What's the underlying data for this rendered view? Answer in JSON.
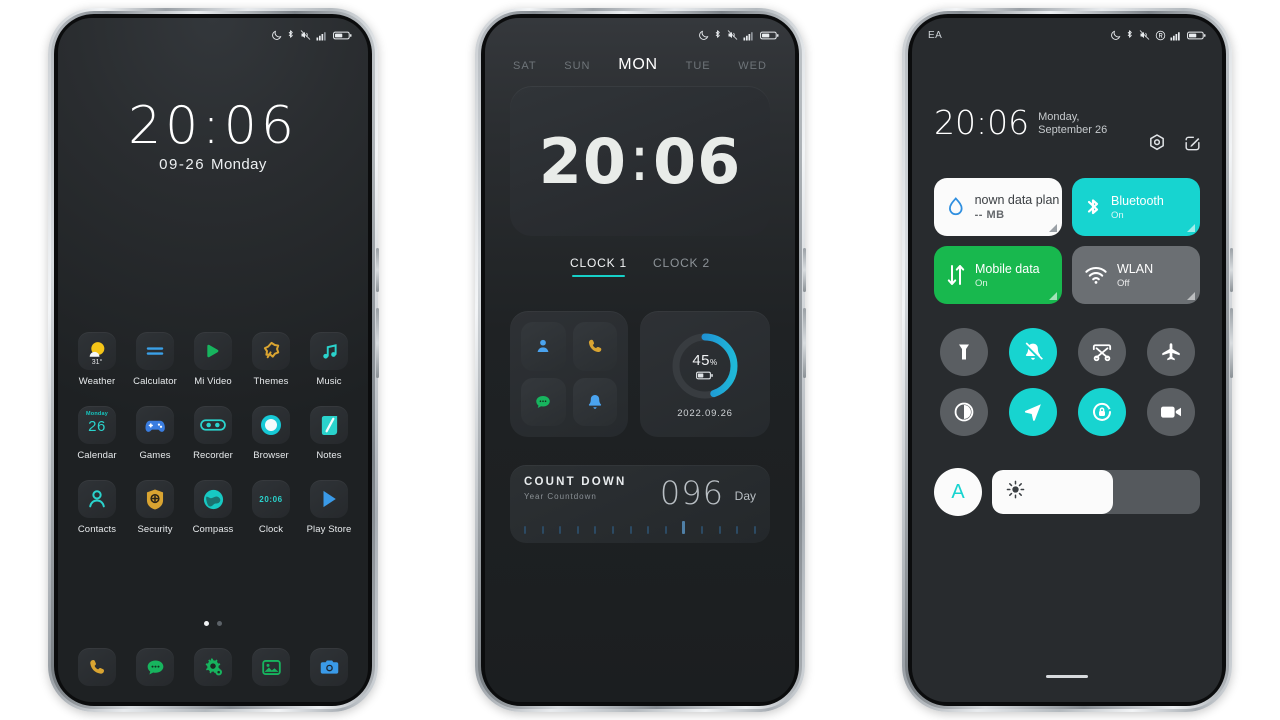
{
  "statusbar": {
    "icons": [
      "moon-icon",
      "bluetooth-icon",
      "vibrate-off-icon",
      "signal-icon",
      "battery-icon"
    ],
    "carrier": "EA",
    "icons_p3": [
      "moon-icon",
      "bluetooth-icon",
      "vibrate-off-icon",
      "registered-icon",
      "signal-icon",
      "battery-icon"
    ]
  },
  "phone1": {
    "lock": {
      "time": "20:06",
      "date": "09-26",
      "weekday": "Monday"
    },
    "apps": [
      [
        {
          "label": "Weather",
          "icon": "weather-sun-cloud-icon",
          "temp": "31°"
        },
        {
          "label": "Calculator",
          "icon": "calculator-equals-icon"
        },
        {
          "label": "Mi Video",
          "icon": "play-triangle-icon"
        },
        {
          "label": "Themes",
          "icon": "themes-star-icon"
        },
        {
          "label": "Music",
          "icon": "music-note-icon"
        }
      ],
      [
        {
          "label": "Calendar",
          "icon": "calendar-icon",
          "dow": "Monday",
          "day": "26"
        },
        {
          "label": "Games",
          "icon": "gamepad-icon"
        },
        {
          "label": "Recorder",
          "icon": "recorder-tape-icon"
        },
        {
          "label": "Browser",
          "icon": "browser-circle-icon"
        },
        {
          "label": "Notes",
          "icon": "notes-pencil-icon"
        }
      ],
      [
        {
          "label": "Contacts",
          "icon": "contacts-person-icon"
        },
        {
          "label": "Security",
          "icon": "security-shield-icon"
        },
        {
          "label": "Compass",
          "icon": "compass-globe-icon"
        },
        {
          "label": "Clock",
          "icon": "clock-digits-icon",
          "time": "20:06"
        },
        {
          "label": "Play Store",
          "icon": "play-store-icon"
        }
      ]
    ],
    "page_dots": {
      "count": 2,
      "active": 0
    },
    "dock": [
      {
        "label": "Phone",
        "icon": "phone-handset-icon"
      },
      {
        "label": "Messages",
        "icon": "message-bubble-icon"
      },
      {
        "label": "Settings",
        "icon": "settings-gears-icon"
      },
      {
        "label": "Gallery",
        "icon": "gallery-picture-icon"
      },
      {
        "label": "Camera",
        "icon": "camera-icon"
      }
    ]
  },
  "phone2": {
    "weekdays": [
      "SAT",
      "SUN",
      "MON",
      "TUE",
      "WED"
    ],
    "today_index": 2,
    "clock": {
      "hours": "20",
      "sep": ":",
      "minutes": "06"
    },
    "tabs": [
      {
        "label": "CLOCK 1",
        "active": true
      },
      {
        "label": "CLOCK 2",
        "active": false
      }
    ],
    "shortcuts": [
      {
        "name": "contact-person-icon"
      },
      {
        "name": "phone-handset-icon"
      },
      {
        "name": "message-bubble-icon"
      },
      {
        "name": "bell-icon"
      }
    ],
    "battery": {
      "percent": "45",
      "unit": "%",
      "date": "2022.09.26",
      "value": 45
    },
    "countdown": {
      "title": "COUNT DOWN",
      "subtitle": "Year Countdown",
      "value": "096",
      "unit": "Day",
      "ticks": 14,
      "highlight_index": 9
    }
  },
  "phone3": {
    "time": "20:06",
    "date": "Monday, September 26",
    "actions": [
      {
        "name": "settings-gear-icon"
      },
      {
        "name": "edit-pencil-icon"
      }
    ],
    "tiles": [
      {
        "title": "nown data plan",
        "sub": "-- MB",
        "style": "white",
        "icon": "data-droplet-icon"
      },
      {
        "title": "Bluetooth",
        "sub": "On",
        "style": "cyan",
        "icon": "bluetooth-icon"
      },
      {
        "title": "Mobile data",
        "sub": "On",
        "style": "green",
        "icon": "mobile-data-arrows-icon"
      },
      {
        "title": "WLAN",
        "sub": "Off",
        "style": "grey",
        "icon": "wifi-icon"
      }
    ],
    "toggles": [
      {
        "name": "flashlight-icon",
        "on": false
      },
      {
        "name": "silent-bell-icon",
        "on": true
      },
      {
        "name": "screenshot-icon",
        "on": false
      },
      {
        "name": "airplane-icon",
        "on": false
      },
      {
        "name": "dark-mode-icon",
        "on": false
      },
      {
        "name": "location-icon",
        "on": true
      },
      {
        "name": "rotation-lock-icon",
        "on": true
      },
      {
        "name": "screen-record-icon",
        "on": false
      }
    ],
    "brightness": {
      "auto_label": "A",
      "level": 58,
      "icon": "brightness-sun-icon"
    }
  },
  "colors": {
    "cyan": "#17d4d0",
    "green": "#18b84e",
    "grey": "#6b6f73",
    "blue": "#2f8fe0",
    "gold": "#d9a431",
    "screen_bg": "#222528"
  }
}
